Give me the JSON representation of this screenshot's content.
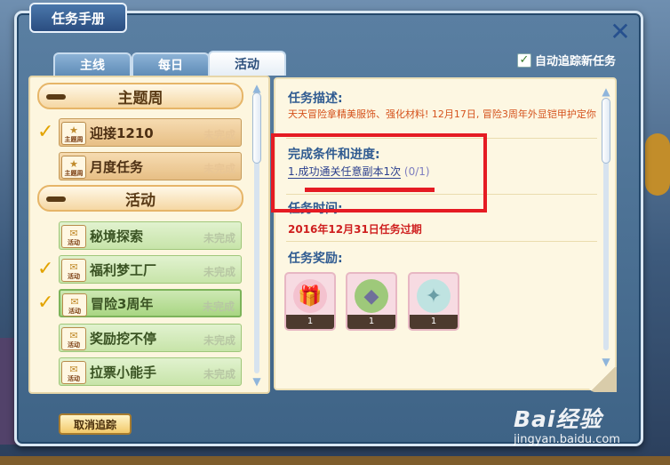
{
  "window": {
    "title": "任务手册",
    "close_icon": "close-x-icon"
  },
  "tabs": [
    {
      "label": "主线",
      "active": false
    },
    {
      "label": "每日",
      "active": false
    },
    {
      "label": "活动",
      "active": true
    }
  ],
  "auto_track": {
    "label": "自动追踪新任务",
    "checked": true
  },
  "task_list": {
    "groups": [
      {
        "label": "主题周",
        "items": [
          {
            "label": "迎接1210",
            "status": "未完成",
            "checked": true,
            "icon_label": "主题周",
            "icon": "star-icon"
          },
          {
            "label": "月度任务",
            "status": "未完成",
            "checked": false,
            "icon_label": "主题周",
            "icon": "star-icon"
          }
        ]
      },
      {
        "label": "活动",
        "items": [
          {
            "label": "秘境探索",
            "status": "未完成",
            "checked": false,
            "icon_label": "活动",
            "icon": "scroll-icon"
          },
          {
            "label": "福利梦工厂",
            "status": "未完成",
            "checked": true,
            "icon_label": "活动",
            "icon": "scroll-icon"
          },
          {
            "label": "冒险3周年",
            "status": "未完成",
            "checked": true,
            "selected": true,
            "icon_label": "活动",
            "icon": "scroll-icon"
          },
          {
            "label": "奖励挖不停",
            "status": "未完成",
            "checked": false,
            "icon_label": "活动",
            "icon": "scroll-icon"
          },
          {
            "label": "拉票小能手",
            "status": "未完成",
            "checked": false,
            "icon_label": "活动",
            "icon": "scroll-icon"
          }
        ]
      }
    ]
  },
  "detail": {
    "description_title": "任务描述:",
    "description_text": "天天冒险拿精美服饰、强化材料! 12月17日, 冒险3周年外显铠甲护定你",
    "condition_title": "完成条件和进度:",
    "condition_text": "1.成功通关任意副本1次",
    "condition_progress": "(0/1)",
    "time_title": "任务时间:",
    "time_text": "2016年12月31日任务过期",
    "reward_title": "任务奖励:",
    "rewards": [
      {
        "icon": "gift-box-icon",
        "count": "1"
      },
      {
        "icon": "crystal-shard-icon",
        "count": "1"
      },
      {
        "icon": "gem-orb-icon",
        "count": "1"
      }
    ]
  },
  "cancel_track_label": "取消追踪",
  "watermark": {
    "logo": "Bai经验",
    "url": "jingyan.baidu.com"
  },
  "colors": {
    "highlight": "#e51b23",
    "dialog_bg": "#4a6f94",
    "accent_text": "#2f5b91",
    "warning_text": "#cf2020"
  }
}
